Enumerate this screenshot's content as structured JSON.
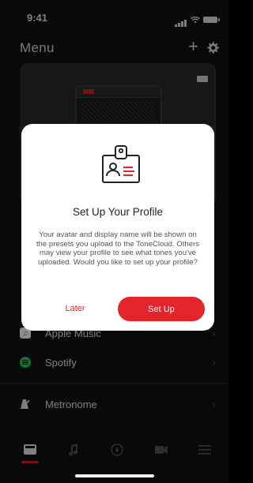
{
  "status_bar": {
    "time": "9:41"
  },
  "header": {
    "title": "Menu",
    "plus_icon": "+"
  },
  "menu": {
    "items": [
      {
        "label": "Apple Music",
        "icon": "music-note-icon"
      },
      {
        "label": "Spotify",
        "icon": "spotify-icon"
      },
      {
        "label": "Metronome",
        "icon": "metronome-icon"
      }
    ]
  },
  "tabbar": {
    "tabs": [
      "amp-icon",
      "music-icon",
      "compass-icon",
      "video-icon",
      "hamburger-icon"
    ],
    "active_index": 0
  },
  "dialog": {
    "title": "Set Up Your Profile",
    "body": "Your avatar and display name will be shown on the presets you upload to the ToneCloud. Others may view your profile to see what tones you've uploaded. Would you like to set up your profile?",
    "later_label": "Later",
    "setup_label": "Set Up"
  },
  "colors": {
    "accent": "#e3242b",
    "background": "#121212",
    "dialog_background": "#ffffff"
  }
}
